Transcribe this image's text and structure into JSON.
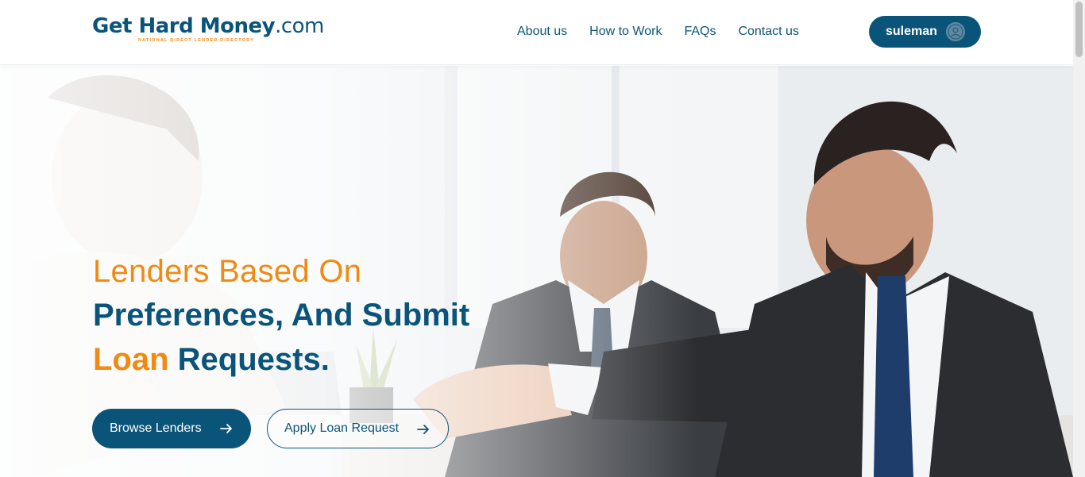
{
  "header": {
    "logo_text_main": "Get Hard Money",
    "logo_text_suffix": ".com",
    "logo_tagline": "NATIONAL DIRECT LENDER DIRECTORY",
    "nav": [
      {
        "label": "About us"
      },
      {
        "label": "How to Work"
      },
      {
        "label": "FAQs"
      },
      {
        "label": "Contact us"
      }
    ],
    "user": {
      "name": "suleman",
      "avatar_icon": "user-icon"
    }
  },
  "hero": {
    "line1": "Lenders Based On",
    "line2": "Preferences, And Submit",
    "line3_orange": "Loan",
    "line3_blue": "Requests.",
    "browse_label": "Browse Lenders",
    "apply_label": "Apply Loan Request",
    "arrow_icon": "arrow-right-icon"
  },
  "colors": {
    "brand_blue": "#0b5479",
    "brand_orange": "#f08a12"
  }
}
